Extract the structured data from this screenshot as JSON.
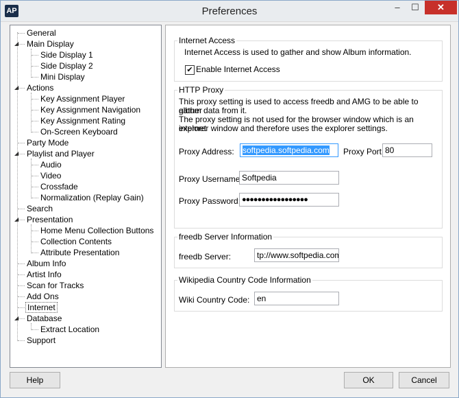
{
  "window": {
    "title": "Preferences",
    "icon_text": "AP",
    "min_glyph": "–",
    "max_glyph": "☐",
    "close_glyph": "✕"
  },
  "tree": {
    "items": [
      {
        "label": "General"
      },
      {
        "label": "Main Display"
      },
      {
        "label": "Side Display 1"
      },
      {
        "label": "Side Display 2"
      },
      {
        "label": "Mini Display"
      },
      {
        "label": "Actions"
      },
      {
        "label": "Key Assignment Player"
      },
      {
        "label": "Key Assignment Navigation"
      },
      {
        "label": "Key Assignment Rating"
      },
      {
        "label": "On-Screen Keyboard"
      },
      {
        "label": "Party Mode"
      },
      {
        "label": "Playlist and Player"
      },
      {
        "label": "Audio"
      },
      {
        "label": "Video"
      },
      {
        "label": "Crossfade"
      },
      {
        "label": "Normalization (Replay Gain)"
      },
      {
        "label": "Search"
      },
      {
        "label": "Presentation"
      },
      {
        "label": "Home Menu Collection Buttons"
      },
      {
        "label": "Collection Contents"
      },
      {
        "label": "Attribute Presentation"
      },
      {
        "label": "Album Info"
      },
      {
        "label": "Artist Info"
      },
      {
        "label": "Scan for Tracks"
      },
      {
        "label": "Add Ons"
      },
      {
        "label": "Internet"
      },
      {
        "label": "Database"
      },
      {
        "label": "Extract Location"
      },
      {
        "label": "Support"
      }
    ],
    "selected": "Internet"
  },
  "internet_access": {
    "title": "Internet Access",
    "description": "Internet Access is used to gather and show Album information.",
    "enable_label": "Enable Internet Access",
    "enabled": true,
    "check_glyph": "✔"
  },
  "http_proxy": {
    "title": "HTTP Proxy",
    "line1": "This proxy setting is used to access freedb and AMG to be able to gather",
    "line2": "album data from it.",
    "line3": "The proxy setting is not used for the browser window which is an internet",
    "line4": "explorer window and therefore uses the explorer settings.",
    "address_label": "Proxy Address:",
    "address_value": "softpedia.softpedia.com",
    "port_label": "Proxy Port:",
    "port_value": "80",
    "username_label": "Proxy Username:",
    "username_value": "Softpedia",
    "password_label": "Proxy Password:",
    "password_value": "●●●●●●●●●●●●●●●●●"
  },
  "freedb": {
    "title": "freedb Server Information",
    "server_label": "freedb Server:",
    "server_value": "tp://www.softpedia.com"
  },
  "wikipedia": {
    "title": "Wikipedia Country Code Information",
    "code_label": "Wiki Country Code:",
    "code_value": "en"
  },
  "buttons": {
    "help": "Help",
    "ok": "OK",
    "cancel": "Cancel"
  }
}
